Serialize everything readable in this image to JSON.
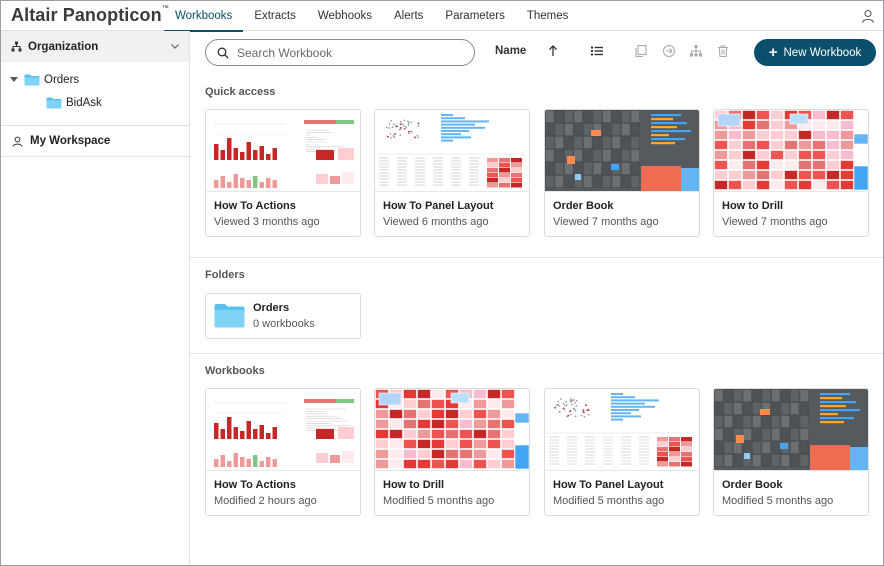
{
  "app": {
    "name": "Altair Panopticon",
    "trademark": "™"
  },
  "nav": {
    "tabs": [
      {
        "label": "Workbooks",
        "active": true
      },
      {
        "label": "Extracts"
      },
      {
        "label": "Webhooks"
      },
      {
        "label": "Alerts"
      },
      {
        "label": "Parameters"
      },
      {
        "label": "Themes"
      }
    ]
  },
  "sidebar": {
    "organization_label": "Organization",
    "tree": [
      {
        "label": "Orders",
        "expanded": true
      },
      {
        "label": "BidAsk"
      }
    ],
    "workspace_label": "My Workspace"
  },
  "toolbar": {
    "search_placeholder": "Search Workbook",
    "sort_label": "Name",
    "new_button_label": "New Workbook",
    "accent": "#0b4f6c"
  },
  "sections": {
    "quick_access": "Quick access",
    "folders": "Folders",
    "workbooks": "Workbooks"
  },
  "quick_access": [
    {
      "name": "How To Actions",
      "sub": "Viewed 3 months ago",
      "thumb": "actions"
    },
    {
      "name": "How To Panel Layout",
      "sub": "Viewed 6 months ago",
      "thumb": "panel"
    },
    {
      "name": "Order Book",
      "sub": "Viewed 7 months ago",
      "thumb": "orderbook"
    },
    {
      "name": "How to Drill",
      "sub": "Viewed 7 months ago",
      "thumb": "drill"
    }
  ],
  "folders": [
    {
      "name": "Orders",
      "sub": "0 workbooks"
    }
  ],
  "workbooks": [
    {
      "name": "How To Actions",
      "sub": "Modified 2 hours ago",
      "thumb": "actions"
    },
    {
      "name": "How to Drill",
      "sub": "Modified 5 months ago",
      "thumb": "drill"
    },
    {
      "name": "How To Panel Layout",
      "sub": "Modified 5 months ago",
      "thumb": "panel"
    },
    {
      "name": "Order Book",
      "sub": "Modified 5 months ago",
      "thumb": "orderbook"
    }
  ]
}
